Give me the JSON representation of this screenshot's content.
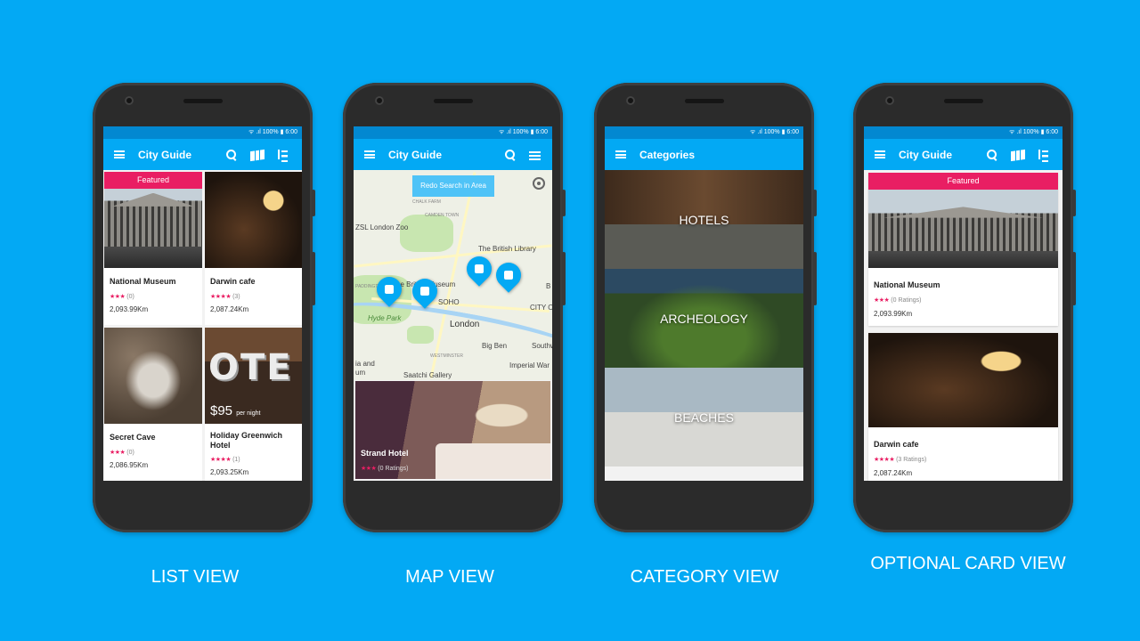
{
  "status_bar": "ᯤ .ıl 100% ▮ 6:00",
  "list_view": {
    "title": "City Guide",
    "featured_label": "Featured",
    "items": [
      {
        "name": "National Museum",
        "stars": "★★★",
        "ratings": "(0)",
        "distance": "2,093.99Km"
      },
      {
        "name": "Darwin cafe",
        "stars": "★★★★",
        "ratings": "(3)",
        "distance": "2,087.24Km"
      },
      {
        "name": "Secret Cave",
        "stars": "★★★",
        "ratings": "(0)",
        "distance": "2,086.95Km"
      },
      {
        "name": "Holiday Greenwich Hotel",
        "stars": "★★★★",
        "ratings": "(1)",
        "distance": "2,093.25Km",
        "price": "$95",
        "price_unit": "per night"
      }
    ]
  },
  "map_view": {
    "title": "City Guide",
    "redo_search": "Redo Search in Area",
    "labels": {
      "chalk_farm": "CHALK FARM",
      "camden": "CAMDEN TOWN",
      "zoo": "ZSL London Zoo",
      "library": "The British Library",
      "museum": "he British Museum",
      "soho": "SOHO",
      "hyde": "Hyde Park",
      "london": "London",
      "city": "CITY OF",
      "big_ben": "Big Ben",
      "westminster": "WESTMINSTER",
      "war": "Imperial War",
      "southwark": "Southwark",
      "saatchi": "Saatchi Gallery",
      "paddington": "PADDINGTO",
      "ia_and": "ia and",
      "um": "um",
      "b": "B"
    },
    "card": {
      "name": "Strand Hotel",
      "stars": "★★★",
      "ratings": "(0 Ratings)"
    }
  },
  "category_view": {
    "title": "Categories",
    "categories": [
      "HOTELS",
      "ARCHEOLOGY",
      "BEACHES"
    ]
  },
  "card_view": {
    "title": "City Guide",
    "featured_label": "Featured",
    "items": [
      {
        "name": "National Museum",
        "stars": "★★★",
        "ratings": "(0 Ratings)",
        "distance": "2,093.99Km"
      },
      {
        "name": "Darwin cafe",
        "stars": "★★★★",
        "ratings": "(3 Ratings)",
        "distance": "2,087.24Km"
      }
    ]
  },
  "captions": {
    "list": "LIST VIEW",
    "map": "MAP VIEW",
    "category": "CATEGORY VIEW",
    "card": "OPTIONAL CARD VIEW"
  },
  "colors": {
    "background": "#03a9f4",
    "toolbar": "#03a9f4",
    "status": "#0288d1",
    "accent": "#e91e63"
  },
  "icons": [
    "menu-icon",
    "search-icon",
    "map-icon",
    "sort-icon",
    "list-icon",
    "locate-icon",
    "map-pin-icon"
  ]
}
